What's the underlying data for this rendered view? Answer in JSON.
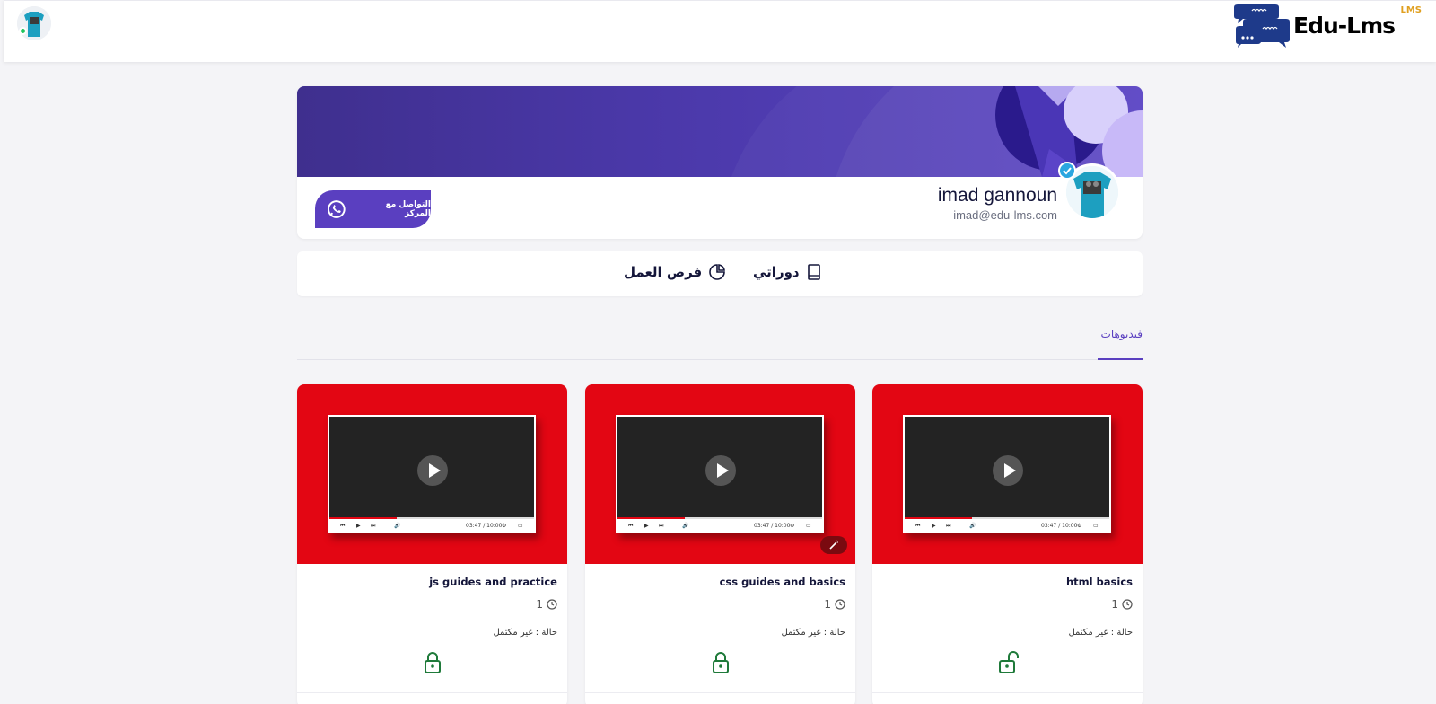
{
  "app": {
    "logo_text": "Edu-Lms",
    "logo_sub": "LMS"
  },
  "profile": {
    "name": "imad gannoun",
    "email": "imad@edu-lms.com",
    "contact_label": "التواصل مع المركز"
  },
  "tabs": [
    {
      "label": "دوراتي",
      "icon": "book-icon"
    },
    {
      "label": "فرص العمل",
      "icon": "pie-chart-icon"
    }
  ],
  "section_tab": "فيديوهات",
  "courses": [
    {
      "title": "html basics",
      "count": "1",
      "status": "حالة : غير مكتمل",
      "lock": "unlocked"
    },
    {
      "title": "css guides and basics",
      "count": "1",
      "status": "حالة : غير مكتمل",
      "lock": "locked"
    },
    {
      "title": "js guides and practice",
      "count": "1",
      "status": "حالة : غير مكتمل",
      "lock": "locked"
    }
  ],
  "player_time": "03:47 / 10:00",
  "colors": {
    "accent": "#5a3fc0",
    "thumb_red": "#e30613",
    "lock_green": "#1f7a3a",
    "online": "#22c55e"
  }
}
